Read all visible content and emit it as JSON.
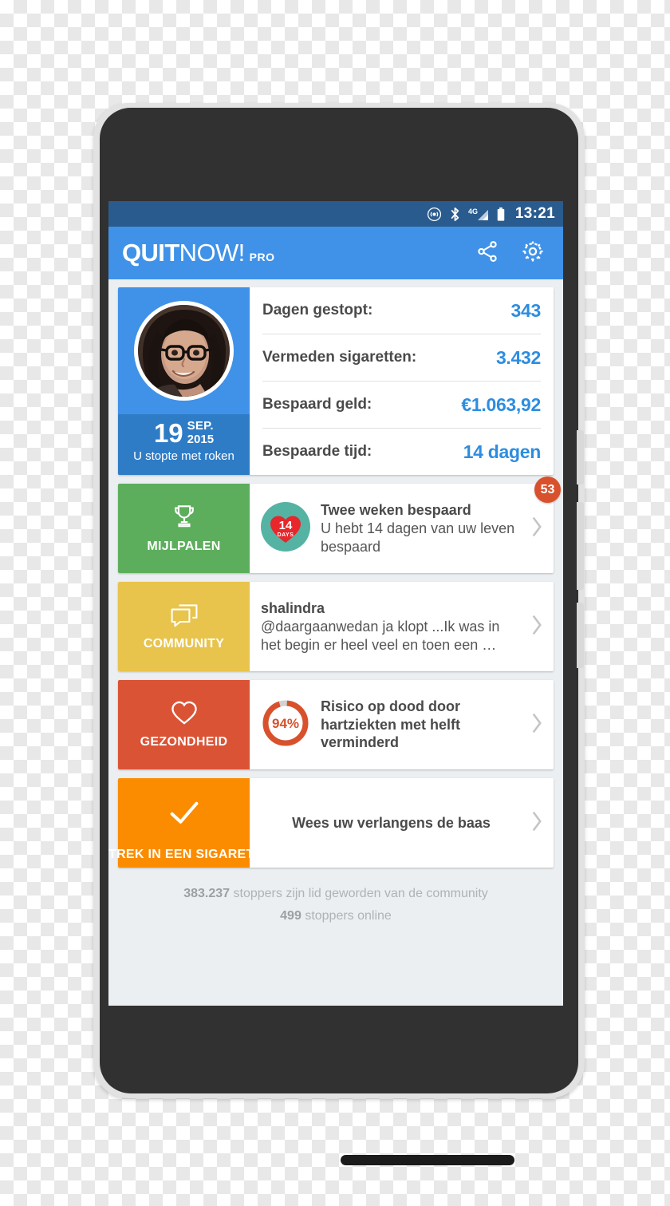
{
  "status_bar": {
    "time": "13:21",
    "icons": [
      "hotspot-icon",
      "bluetooth-icon",
      "signal-4g-icon",
      "battery-icon"
    ],
    "network": "4G",
    "background": "#2a5b8e"
  },
  "app_bar": {
    "logo_quit": "QUIT",
    "logo_now": "NOW!",
    "logo_pro": "PRO",
    "share_icon": "share-icon",
    "settings_icon": "gear-icon",
    "background": "#3f92e8"
  },
  "stats_card": {
    "profile": {
      "avatar": "user-avatar-photo",
      "day": "19",
      "month": "SEP.",
      "year": "2015",
      "caption": "U stopte met roken"
    },
    "rows": [
      {
        "label": "Dagen gestopt:",
        "value": "343"
      },
      {
        "label": "Vermeden sigaretten:",
        "value": "3.432"
      },
      {
        "label": "Bespaard geld:",
        "value": "€1.063,92"
      },
      {
        "label": "Bespaarde tijd:",
        "value": "14 dagen"
      }
    ],
    "value_color": "#2d8de0"
  },
  "sections": [
    {
      "key": "milestones",
      "tile_label": "MIJLPALEN",
      "tile_color": "#5cae5c",
      "icon": "trophy-icon",
      "medal": {
        "days": "14",
        "days_label": "DAYS",
        "circle_color": "#55b3a4",
        "heart_color": "#e8262b"
      },
      "title": "Twee weken bespaard",
      "subtitle": "U hebt 14 dagen van uw leven bespaard",
      "badge": "53",
      "badge_color": "#d9512c"
    },
    {
      "key": "community",
      "tile_label": "COMMUNITY",
      "tile_color": "#e8c44d",
      "icon": "chat-bubbles-icon",
      "title": "shalindra",
      "subtitle": "@daargaanwedan ja klopt ...Ik was in het begin er heel veel en toen een …"
    },
    {
      "key": "health",
      "tile_label": "GEZONDHEID",
      "tile_color": "#da5335",
      "icon": "heart-outline-icon",
      "progress": {
        "percent": 94,
        "label": "94%",
        "ring_color": "#d9512c",
        "track_color": "#d2d2d2"
      },
      "title": "Risico op dood door hartziekten met helft verminderd"
    },
    {
      "key": "craving",
      "tile_label": "TREK IN EEN SIGARET",
      "tile_color": "#fb8c00",
      "icon": "check-icon",
      "title": "Wees uw verlangens de baas"
    }
  ],
  "footer": {
    "members_count": "383.237",
    "members_text": "stoppers zijn lid geworden van de community",
    "online_count": "499",
    "online_text": "stoppers online"
  },
  "nav_bar": {
    "back": "back-triangle-icon",
    "home": "home-circle-icon",
    "recents": "recents-square-icon"
  }
}
